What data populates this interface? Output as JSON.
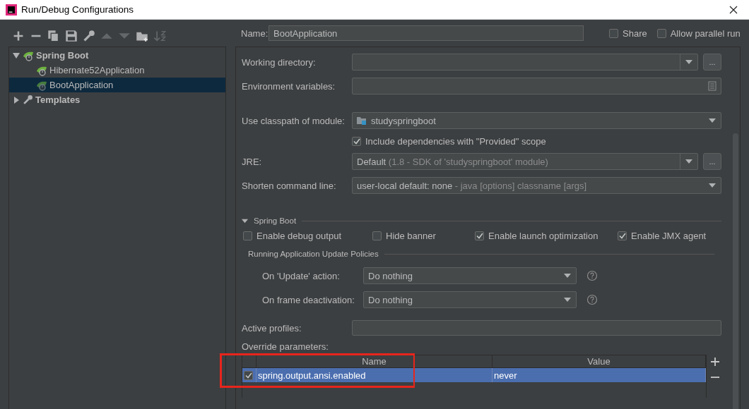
{
  "window": {
    "title": "Run/Debug Configurations"
  },
  "toolbar": [
    {
      "kind": "add",
      "disabled": false
    },
    {
      "kind": "remove",
      "disabled": false
    },
    {
      "kind": "copy",
      "disabled": false
    },
    {
      "kind": "save",
      "disabled": false
    },
    {
      "kind": "wrench",
      "disabled": false
    },
    {
      "kind": "up",
      "disabled": true
    },
    {
      "kind": "down",
      "disabled": true
    },
    {
      "kind": "folder",
      "disabled": false
    },
    {
      "kind": "sort",
      "disabled": true
    }
  ],
  "tree": [
    {
      "label": "Spring Boot",
      "kind": "spring",
      "expanded": true,
      "selected": false,
      "children": [
        {
          "label": "Hibernate52Application",
          "selected": false
        },
        {
          "label": "BootApplication",
          "selected": true
        }
      ]
    },
    {
      "label": "Templates",
      "kind": "templates",
      "expanded": false,
      "selected": false
    }
  ],
  "name_field": {
    "label": "Name:",
    "value": "BootApplication"
  },
  "header_options": [
    {
      "label": "Share",
      "checked": false
    },
    {
      "label": "Allow parallel run",
      "checked": false
    }
  ],
  "fields": [
    {
      "kind": "combo_browse",
      "label": "Working directory:",
      "browse": "..."
    },
    {
      "kind": "text_icon",
      "label": "Environment variables:"
    },
    {
      "kind": "spacer"
    },
    {
      "kind": "module",
      "label": "Use classpath of module:",
      "value": "studyspringboot"
    },
    {
      "kind": "checkbox",
      "label": "Include dependencies with \"Provided\" scope",
      "checked": true
    },
    {
      "kind": "combo_browse",
      "label": "JRE:",
      "value": "Default",
      "hint": "(1.8 - SDK of 'studyspringboot' module)",
      "browse": "..."
    },
    {
      "kind": "combo",
      "label": "Shorten command line:",
      "value": "user-local default: none",
      "hint": "- java [options] classname [args]"
    }
  ],
  "spring_boot": {
    "title": "Spring Boot",
    "expanded": true,
    "options": [
      {
        "label": "Enable debug output",
        "checked": false
      },
      {
        "label": "Hide banner",
        "checked": false
      },
      {
        "label": "Enable launch optimization",
        "checked": true
      },
      {
        "label": "Enable JMX agent",
        "checked": true
      }
    ],
    "policies": {
      "title": "Running Application Update Policies",
      "rows": [
        {
          "label": "On 'Update' action:",
          "value": "Do nothing"
        },
        {
          "label": "On frame deactivation:",
          "value": "Do nothing"
        }
      ]
    }
  },
  "active_profiles": {
    "label": "Active profiles:"
  },
  "override": {
    "label": "Override parameters:",
    "columns": [
      "Name",
      "Value"
    ],
    "rows": [
      {
        "checked": true,
        "selected": true,
        "name": "spring.output.ansi.enabled",
        "value": "never"
      }
    ]
  }
}
